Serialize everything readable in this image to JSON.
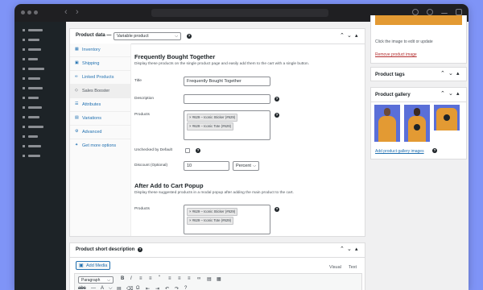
{
  "product_data": {
    "title": "Product data —",
    "type_value": "Variable product",
    "tabs": [
      {
        "icon": "inventory-icon",
        "glyph": "▦",
        "label": "Inventory"
      },
      {
        "icon": "shipping-icon",
        "glyph": "▣",
        "label": "Shipping"
      },
      {
        "icon": "link-icon",
        "glyph": "∞",
        "label": "Linked Products"
      },
      {
        "icon": "booster-icon",
        "glyph": "◇",
        "label": "Sales Booster"
      },
      {
        "icon": "attributes-icon",
        "glyph": "☰",
        "label": "Attributes"
      },
      {
        "icon": "variations-icon",
        "glyph": "▤",
        "label": "Variations"
      },
      {
        "icon": "gear-icon",
        "glyph": "⚙",
        "label": "Advanced"
      },
      {
        "icon": "plugin-icon",
        "glyph": "✦",
        "label": "Get more options"
      }
    ]
  },
  "fbt": {
    "title": "Frequently Bought Together",
    "desc": "Display these products on the single product page and easily add them to the cart with a single button.",
    "title_label": "Title",
    "title_value": "Frequently Bought Together",
    "description_label": "Description",
    "description_value": "",
    "products_label": "Products",
    "products": [
      "× #629 – Iconic Sticker (#629)",
      "× #629 – Iconic Tote (#629)"
    ],
    "unchecked_label": "Unchecked by Default",
    "discount_label": "Discount (Optional)",
    "discount_value": "10",
    "discount_type": "Percent"
  },
  "popup": {
    "title": "After Add to Cart Popup",
    "desc": "Display these suggested products in a modal popup after adding the main product to the cart.",
    "products_label": "Products",
    "products": [
      "× #629 – Iconic Sticker (#629)",
      "× #629 – Iconic Tote (#629)"
    ]
  },
  "short_desc": {
    "title": "Product short description",
    "add_media": "Add Media",
    "tab_visual": "Visual",
    "tab_text": "Text",
    "format_value": "Paragraph"
  },
  "image_box": {
    "hint": "Click the image to edit or update",
    "remove": "Remove product image"
  },
  "tags_box": {
    "title": "Product tags"
  },
  "gallery_box": {
    "title": "Product gallery",
    "add_link": "Add product gallery images"
  },
  "colors": {
    "background": "#7f94f7",
    "accent": "#2271b1",
    "danger": "#b32d2e",
    "admin_bar": "#1d2327"
  }
}
